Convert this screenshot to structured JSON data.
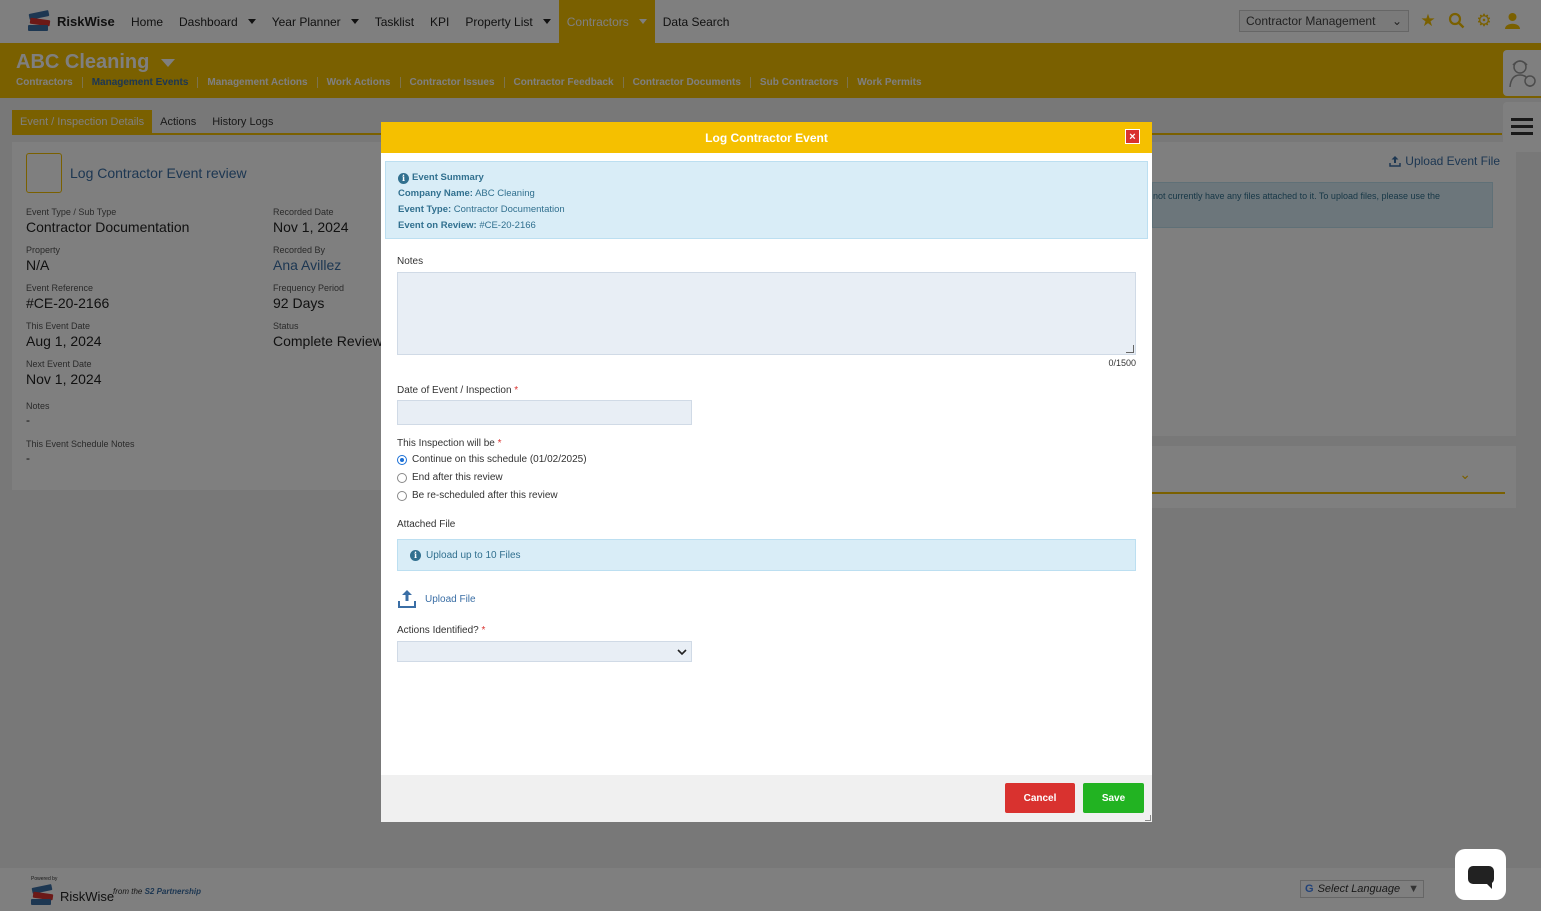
{
  "brand": {
    "name": "RiskWise"
  },
  "nav": {
    "items": [
      {
        "label": "Home",
        "caret": false,
        "active": false
      },
      {
        "label": "Dashboard",
        "caret": true,
        "active": false
      },
      {
        "label": "Year Planner",
        "caret": true,
        "active": false
      },
      {
        "label": "Tasklist",
        "caret": false,
        "active": false
      },
      {
        "label": "KPI",
        "caret": false,
        "active": false
      },
      {
        "label": "Property List",
        "caret": true,
        "active": false
      },
      {
        "label": "Contractors",
        "caret": true,
        "active": true
      },
      {
        "label": "Data Search",
        "caret": false,
        "active": false
      }
    ],
    "module_select": "Contractor Management"
  },
  "header": {
    "title": "ABC Cleaning",
    "subnav": [
      "Contractors",
      "Management Events",
      "Management Actions",
      "Work Actions",
      "Contractor Issues",
      "Contractor Feedback",
      "Contractor Documents",
      "Sub Contractors",
      "Work Permits"
    ],
    "subnav_current": "Management Events"
  },
  "tabs": [
    {
      "label": "Event / Inspection Details",
      "active": true
    },
    {
      "label": "Actions",
      "active": false
    },
    {
      "label": "History Logs",
      "active": false
    }
  ],
  "details": {
    "title": "Log Contractor Event review",
    "left": [
      {
        "label": "Event Type / Sub Type",
        "value": "Contractor Documentation"
      },
      {
        "label": "Property",
        "value": "N/A"
      },
      {
        "label": "Event Reference",
        "value": "#CE-20-2166"
      },
      {
        "label": "This Event Date",
        "value": "Aug 1, 2024"
      },
      {
        "label": "Next Event Date",
        "value": "Nov 1, 2024"
      },
      {
        "label": "Notes",
        "value": "-"
      },
      {
        "label": "This Event Schedule Notes",
        "value": "-"
      }
    ],
    "right": [
      {
        "label": "Recorded Date",
        "value": "Nov 1, 2024"
      },
      {
        "label": "Recorded By",
        "value": "Ana Avillez"
      },
      {
        "label": "Frequency Period",
        "value": "92 Days"
      },
      {
        "label": "Status",
        "value": "Complete Review"
      }
    ]
  },
  "right_panel": {
    "upload_label": "Upload Event File",
    "info_text": "not currently have any files attached to it. To upload files, please use the"
  },
  "modal": {
    "title": "Log Contractor Event",
    "close": "×",
    "summary": {
      "heading": "Event Summary",
      "company_label": "Company Name:",
      "company_value": "ABC Cleaning",
      "type_label": "Event Type:",
      "type_value": "Contractor Documentation",
      "review_label": "Event on Review:",
      "review_value": "#CE-20-2166"
    },
    "notes_label": "Notes",
    "notes_value": "",
    "notes_counter": "0/1500",
    "date_label": "Date of Event / Inspection",
    "date_value": "",
    "inspection_label": "This Inspection will be",
    "options": [
      {
        "label": "Continue on this schedule (01/02/2025)",
        "checked": true
      },
      {
        "label": "End after this review",
        "checked": false
      },
      {
        "label": "Be re-scheduled after this review",
        "checked": false
      }
    ],
    "attached_label": "Attached File",
    "attached_info": "Upload up to 10 Files",
    "upload_file": "Upload File",
    "actions_label": "Actions Identified?",
    "actions_value": "",
    "required_mark": "*",
    "cancel": "Cancel",
    "save": "Save"
  },
  "footer": {
    "powered": "Powered by",
    "brand": "RiskWise",
    "from_text": "from the",
    "partner": "S2 Partnership",
    "language": "Select Language"
  },
  "colors": {
    "accent": "#f5c000",
    "link": "#3a6ea5",
    "danger": "#d9322f",
    "success": "#22b322",
    "info_bg": "#d9edf7"
  }
}
